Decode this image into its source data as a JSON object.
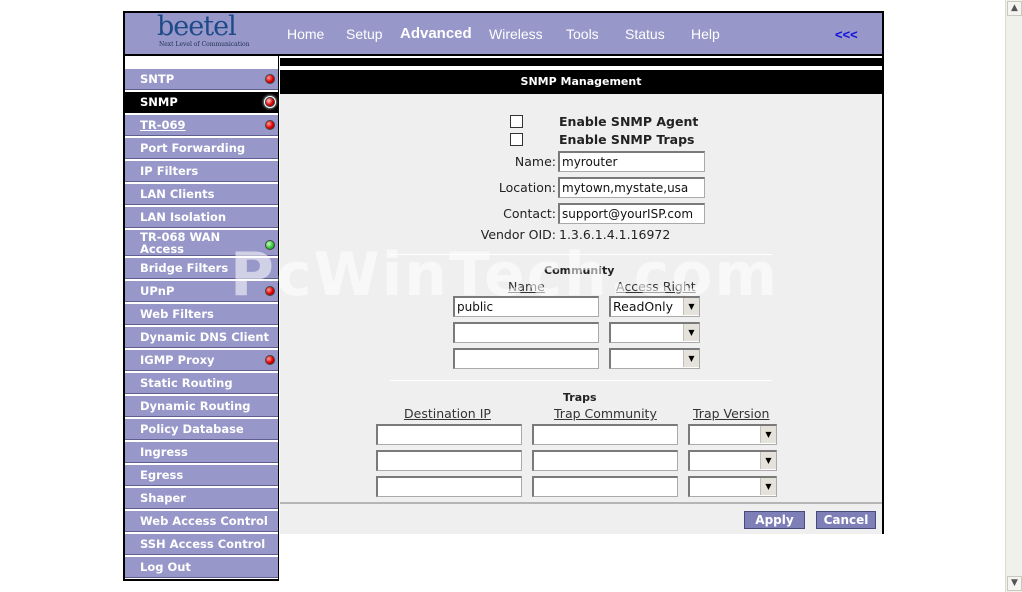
{
  "header": {
    "logo_text": "beetel",
    "logo_tagline": "Next Level of Communication",
    "nav": [
      "Home",
      "Setup",
      "Advanced",
      "Wireless",
      "Tools",
      "Status",
      "Help"
    ],
    "active_nav": "Advanced",
    "back_link": "<<<"
  },
  "sidebar": {
    "items": [
      {
        "label": "SNTP",
        "status": "red"
      },
      {
        "label": "SNMP",
        "status": "red",
        "active": true
      },
      {
        "label": "TR-069",
        "status": "red",
        "underline": true
      },
      {
        "label": "Port Forwarding"
      },
      {
        "label": "IP Filters"
      },
      {
        "label": "LAN Clients"
      },
      {
        "label": "LAN Isolation"
      },
      {
        "label": "TR-068 WAN Access",
        "status": "green"
      },
      {
        "label": "Bridge Filters"
      },
      {
        "label": "UPnP",
        "status": "red"
      },
      {
        "label": "Web Filters"
      },
      {
        "label": "Dynamic DNS Client"
      },
      {
        "label": "IGMP Proxy",
        "status": "red"
      },
      {
        "label": "Static Routing"
      },
      {
        "label": "Dynamic Routing"
      },
      {
        "label": "Policy Database"
      },
      {
        "label": "Ingress"
      },
      {
        "label": "Egress"
      },
      {
        "label": "Shaper"
      },
      {
        "label": "Web Access Control"
      },
      {
        "label": "SSH Access Control"
      },
      {
        "label": "Log Out"
      }
    ]
  },
  "main": {
    "title": "SNMP Management",
    "enable_agent_label": "Enable SNMP Agent",
    "enable_traps_label": "Enable SNMP Traps",
    "enable_agent_checked": false,
    "enable_traps_checked": false,
    "name_label": "Name:",
    "name_value": "myrouter",
    "location_label": "Location:",
    "location_value": "mytown,mystate,usa",
    "contact_label": "Contact:",
    "contact_value": "support@yourISP.com",
    "vendor_oid_label": "Vendor OID:",
    "vendor_oid_value": "1.3.6.1.4.1.16972",
    "community": {
      "heading": "Community",
      "col_name": "Name",
      "col_access": "Access Right",
      "rows": [
        {
          "name": "public",
          "access": "ReadOnly"
        },
        {
          "name": "",
          "access": ""
        },
        {
          "name": "",
          "access": ""
        }
      ]
    },
    "traps": {
      "heading": "Traps",
      "col_dest": "Destination IP",
      "col_community": "Trap Community",
      "col_version": "Trap Version",
      "rows": [
        {
          "dest": "",
          "community": "",
          "version": ""
        },
        {
          "dest": "",
          "community": "",
          "version": ""
        },
        {
          "dest": "",
          "community": "",
          "version": ""
        }
      ]
    }
  },
  "footer": {
    "apply_label": "Apply",
    "cancel_label": "Cancel"
  },
  "watermark": "PcWinTech.com",
  "colors": {
    "brand_bar": "#9797c9",
    "button": "#7f7fb7",
    "back_link": "#1010dd",
    "status_red": "#e00000",
    "status_green": "#37c837"
  }
}
